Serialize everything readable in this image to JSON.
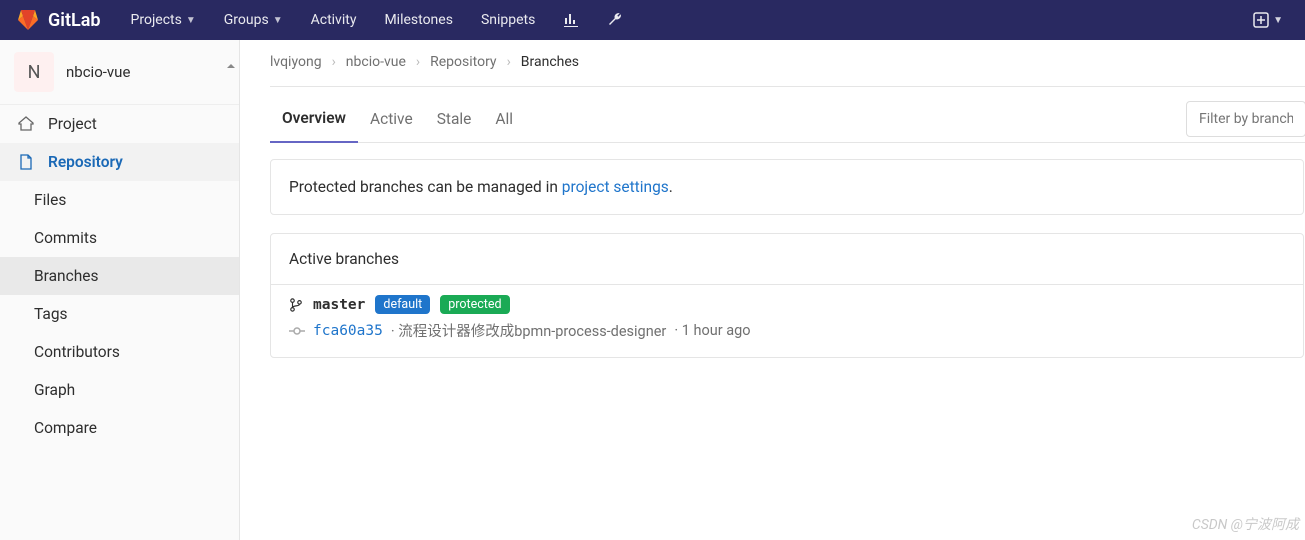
{
  "nav": {
    "brand": "GitLab",
    "items": [
      "Projects",
      "Groups",
      "Activity",
      "Milestones",
      "Snippets"
    ]
  },
  "project": {
    "initial": "N",
    "name": "nbcio-vue"
  },
  "sidebar": {
    "project": "Project",
    "repository": "Repository",
    "sub": [
      "Files",
      "Commits",
      "Branches",
      "Tags",
      "Contributors",
      "Graph",
      "Compare"
    ]
  },
  "crumbs": [
    "lvqiyong",
    "nbcio-vue",
    "Repository",
    "Branches"
  ],
  "tabs": [
    "Overview",
    "Active",
    "Stale",
    "All"
  ],
  "filter": {
    "placeholder": "Filter by branch"
  },
  "notice": {
    "text": "Protected branches can be managed in ",
    "link": "project settings",
    "tail": "."
  },
  "panel": {
    "title": "Active branches"
  },
  "branch": {
    "name": "master",
    "badges": {
      "default": "default",
      "protected": "protected"
    },
    "sha": "fca60a35",
    "message": "流程设计器修改成bpmn-process-designer",
    "time": "1 hour ago"
  },
  "watermark": "CSDN @宁波阿成"
}
